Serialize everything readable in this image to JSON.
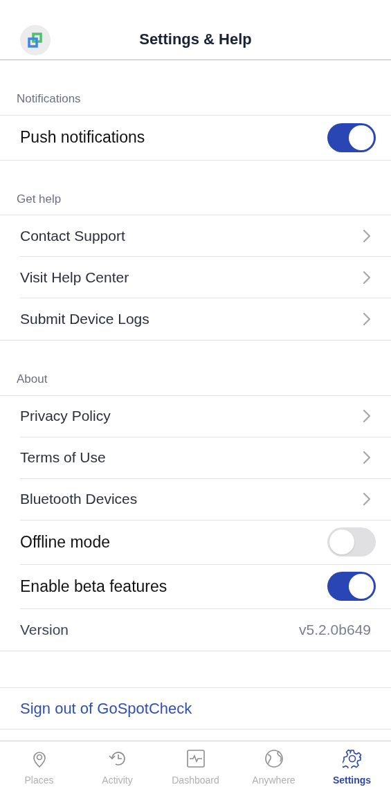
{
  "header": {
    "title": "Settings & Help"
  },
  "sections": [
    {
      "title": "Notifications",
      "items": [
        {
          "kind": "toggle",
          "label": "Push notifications",
          "on": true
        }
      ]
    },
    {
      "title": "Get help",
      "items": [
        {
          "kind": "link",
          "label": "Contact Support"
        },
        {
          "kind": "link",
          "label": "Visit Help Center"
        },
        {
          "kind": "link",
          "label": "Submit Device Logs"
        }
      ]
    },
    {
      "title": "About",
      "items": [
        {
          "kind": "link",
          "label": "Privacy Policy"
        },
        {
          "kind": "link",
          "label": "Terms of Use"
        },
        {
          "kind": "link",
          "label": "Bluetooth Devices"
        },
        {
          "kind": "toggle",
          "label": "Offline mode",
          "on": false
        },
        {
          "kind": "toggle",
          "label": "Enable beta features",
          "on": true
        },
        {
          "kind": "value",
          "label": "Version",
          "value": "v5.2.0b649"
        }
      ]
    }
  ],
  "sign_out": "Sign out of GoSpotCheck",
  "tab_bar": [
    {
      "kind": "pin",
      "label": "Places",
      "selected": false
    },
    {
      "kind": "history",
      "label": "Activity",
      "selected": false
    },
    {
      "kind": "pulse",
      "label": "Dashboard",
      "selected": false
    },
    {
      "kind": "globe",
      "label": "Anywhere",
      "selected": false
    },
    {
      "kind": "gear",
      "label": "Settings",
      "selected": true
    }
  ]
}
